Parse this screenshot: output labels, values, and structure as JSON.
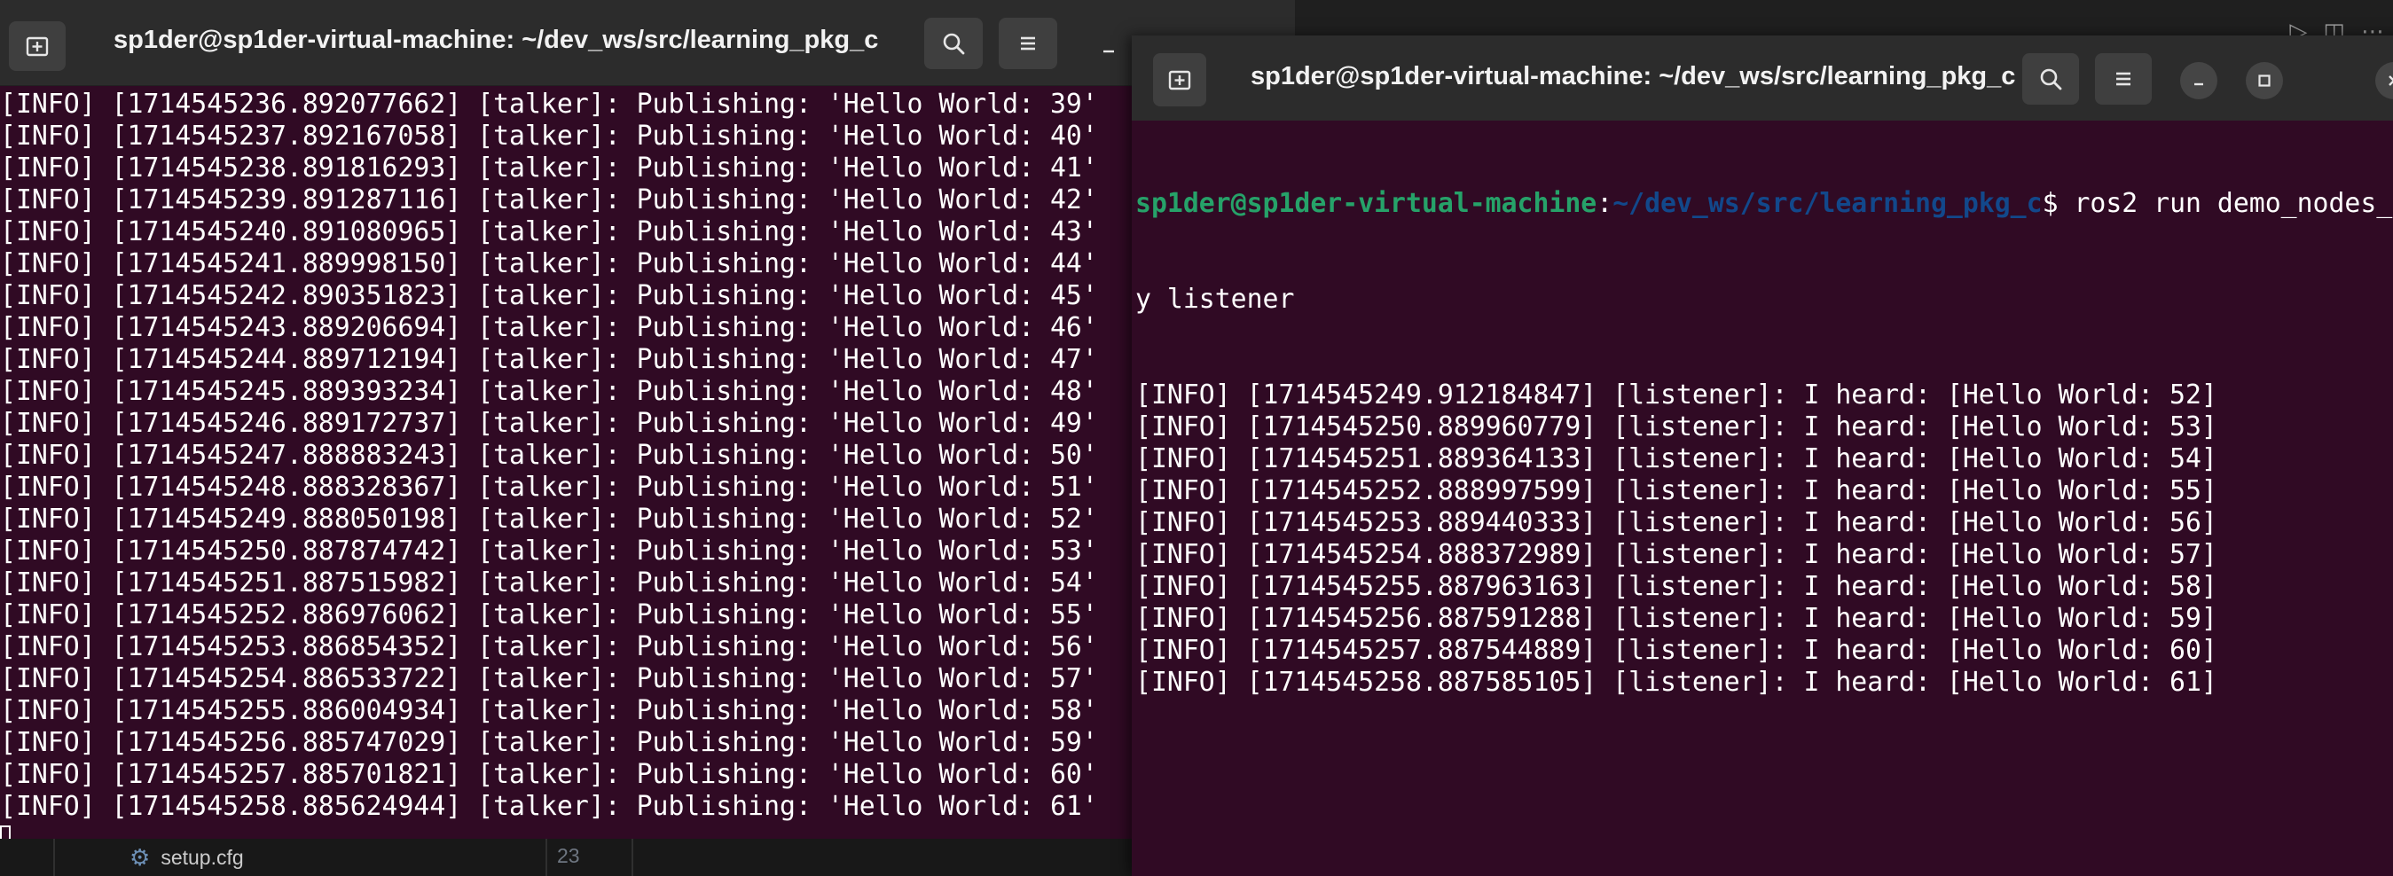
{
  "editor": {
    "file_name": "setup.cfg",
    "line_number": "23",
    "toolbar_icons": [
      "run-icon",
      "split-editor-icon",
      "more-icon"
    ]
  },
  "terminal_left": {
    "title": "sp1der@sp1der-virtual-machine: ~/dev_ws/src/learning_pkg_c",
    "lines": [
      "[INFO] [1714545236.892077662] [talker]: Publishing: 'Hello World: 39'",
      "[INFO] [1714545237.892167058] [talker]: Publishing: 'Hello World: 40'",
      "[INFO] [1714545238.891816293] [talker]: Publishing: 'Hello World: 41'",
      "[INFO] [1714545239.891287116] [talker]: Publishing: 'Hello World: 42'",
      "[INFO] [1714545240.891080965] [talker]: Publishing: 'Hello World: 43'",
      "[INFO] [1714545241.889998150] [talker]: Publishing: 'Hello World: 44'",
      "[INFO] [1714545242.890351823] [talker]: Publishing: 'Hello World: 45'",
      "[INFO] [1714545243.889206694] [talker]: Publishing: 'Hello World: 46'",
      "[INFO] [1714545244.889712194] [talker]: Publishing: 'Hello World: 47'",
      "[INFO] [1714545245.889393234] [talker]: Publishing: 'Hello World: 48'",
      "[INFO] [1714545246.889172737] [talker]: Publishing: 'Hello World: 49'",
      "[INFO] [1714545247.888883243] [talker]: Publishing: 'Hello World: 50'",
      "[INFO] [1714545248.888328367] [talker]: Publishing: 'Hello World: 51'",
      "[INFO] [1714545249.888050198] [talker]: Publishing: 'Hello World: 52'",
      "[INFO] [1714545250.887874742] [talker]: Publishing: 'Hello World: 53'",
      "[INFO] [1714545251.887515982] [talker]: Publishing: 'Hello World: 54'",
      "[INFO] [1714545252.886976062] [talker]: Publishing: 'Hello World: 55'",
      "[INFO] [1714545253.886854352] [talker]: Publishing: 'Hello World: 56'",
      "[INFO] [1714545254.886533722] [talker]: Publishing: 'Hello World: 57'",
      "[INFO] [1714545255.886004934] [talker]: Publishing: 'Hello World: 58'",
      "[INFO] [1714545256.885747029] [talker]: Publishing: 'Hello World: 59'",
      "[INFO] [1714545257.885701821] [talker]: Publishing: 'Hello World: 60'",
      "[INFO] [1714545258.885624944] [talker]: Publishing: 'Hello World: 61'"
    ]
  },
  "terminal_right": {
    "title": "sp1der@sp1der-virtual-machine: ~/dev_ws/src/learning_pkg_c",
    "prompt_user": "sp1der@sp1der-virtual-machine",
    "prompt_sep": ":",
    "prompt_path": "~/dev_ws/src/learning_pkg_c",
    "prompt_symbol": "$ ",
    "command_part1": "ros2 run demo_nodes_",
    "command_part2": "y listener",
    "lines": [
      "[INFO] [1714545249.912184847] [listener]: I heard: [Hello World: 52]",
      "[INFO] [1714545250.889960779] [listener]: I heard: [Hello World: 53]",
      "[INFO] [1714545251.889364133] [listener]: I heard: [Hello World: 54]",
      "[INFO] [1714545252.888997599] [listener]: I heard: [Hello World: 55]",
      "[INFO] [1714545253.889440333] [listener]: I heard: [Hello World: 56]",
      "[INFO] [1714545254.888372989] [listener]: I heard: [Hello World: 57]",
      "[INFO] [1714545255.887963163] [listener]: I heard: [Hello World: 58]",
      "[INFO] [1714545256.887591288] [listener]: I heard: [Hello World: 59]",
      "[INFO] [1714545257.887544889] [listener]: I heard: [Hello World: 60]",
      "[INFO] [1714545258.887585105] [listener]: I heard: [Hello World: 61]"
    ]
  },
  "colors": {
    "terminal_bg": "#300a24",
    "titlebar_bg": "#2c2c2c",
    "prompt_user": "#26a269",
    "prompt_path": "#12488b",
    "text": "#ffffff"
  }
}
